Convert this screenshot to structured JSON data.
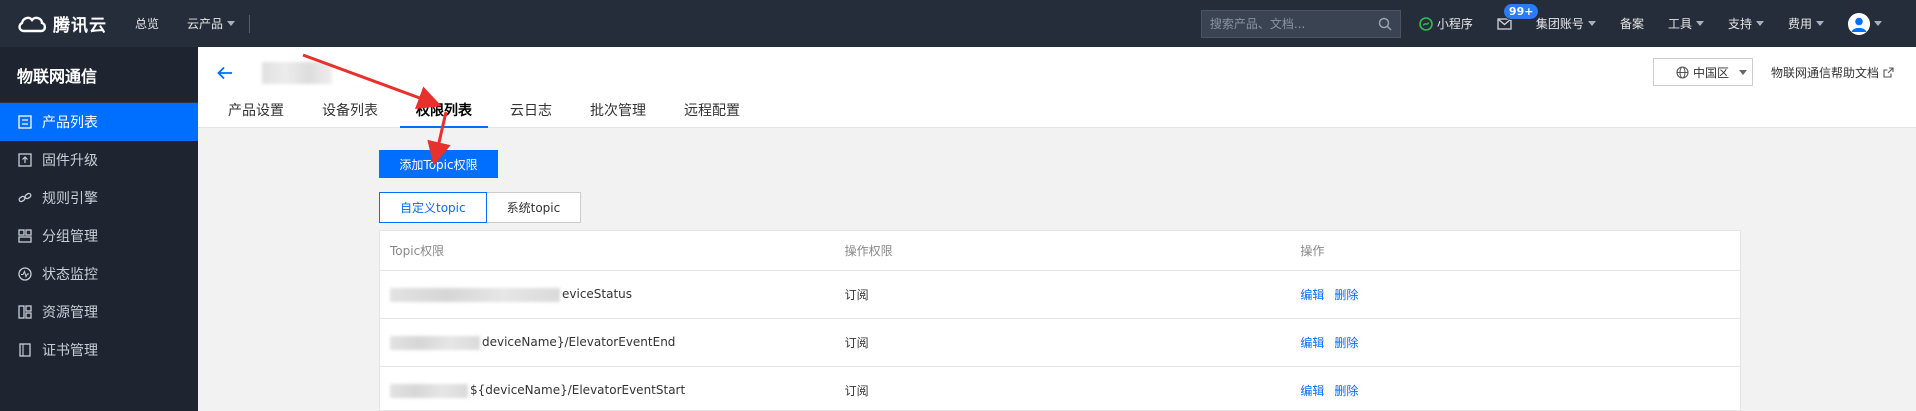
{
  "topbar": {
    "brand": "腾讯云",
    "nav": [
      "总览",
      "云产品"
    ],
    "search_placeholder": "搜索产品、文档...",
    "miniprogram": "小程序",
    "message_badge": "99+",
    "account": "集团账号",
    "beian": "备案",
    "tools": "工具",
    "support": "支持",
    "billing": "费用"
  },
  "sidebar": {
    "title": "物联网通信",
    "items": [
      {
        "label": "产品列表",
        "icon": "list-icon",
        "active": true
      },
      {
        "label": "固件升级",
        "icon": "upload-icon",
        "active": false
      },
      {
        "label": "规则引擎",
        "icon": "link-icon",
        "active": false
      },
      {
        "label": "分组管理",
        "icon": "group-icon",
        "active": false
      },
      {
        "label": "状态监控",
        "icon": "monitor-icon",
        "active": false
      },
      {
        "label": "资源管理",
        "icon": "resource-icon",
        "active": false
      },
      {
        "label": "证书管理",
        "icon": "certificate-icon",
        "active": false
      }
    ]
  },
  "header": {
    "tabs": [
      "产品设置",
      "设备列表",
      "权限列表",
      "云日志",
      "批次管理",
      "远程配置"
    ],
    "active_tab": 2,
    "region": "中国区",
    "help": "物联网通信帮助文档"
  },
  "main": {
    "add_button": "添加Topic权限",
    "segments": [
      "自定义topic",
      "系统topic"
    ],
    "table": {
      "headers": [
        "Topic权限",
        "操作权限",
        "操作"
      ],
      "rows": [
        {
          "topic_suffix": "eviceStatus",
          "permission": "订阅"
        },
        {
          "topic_suffix": "deviceName}/ElevatorEventEnd",
          "permission": "订阅"
        },
        {
          "topic_suffix": "${deviceName}/ElevatorEventStart",
          "permission": "订阅"
        }
      ],
      "edit": "编辑",
      "delete": "删除"
    }
  },
  "colors": {
    "primary": "#006eff",
    "topbar": "#252d3b",
    "sidebar": "#1e2531",
    "annotation": "#e8302c"
  }
}
